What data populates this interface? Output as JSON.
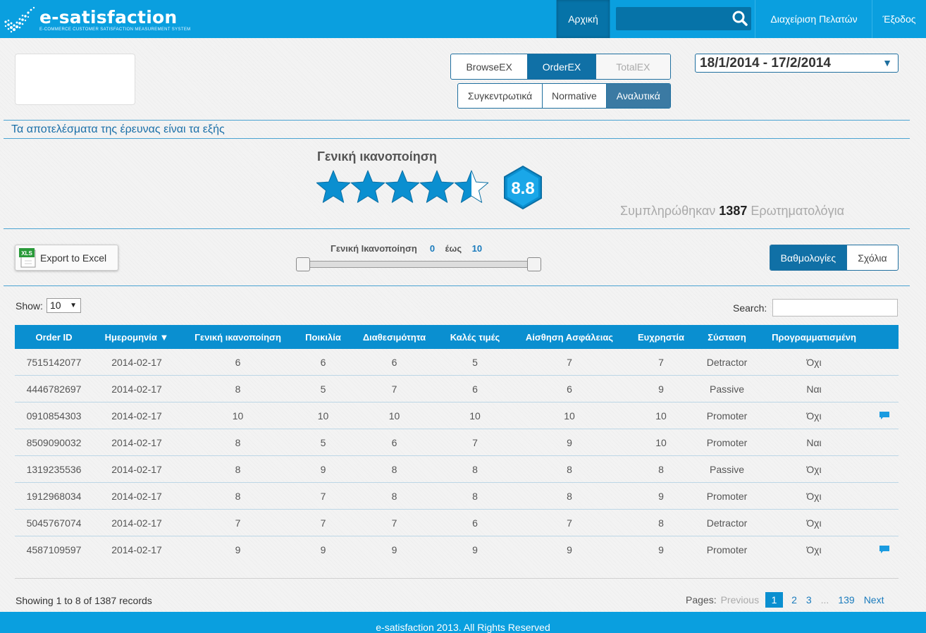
{
  "header": {
    "brand": "e-satisfaction",
    "brand_tagline": "E-COMMERCE CUSTOMER SATISFACTION MEASUREMENT SYSTEM",
    "nav_home": "Αρχική",
    "nav_clients": "Διαχείριση Πελατών",
    "nav_exit": "Έξοδος",
    "search_value": "",
    "accent_color": "#0a9fdf"
  },
  "modes": {
    "survey_types": [
      "BrowseEX",
      "OrderEX",
      "TotalEX"
    ],
    "survey_active": "OrderEX",
    "views": [
      "Συγκεντρωτικά",
      "Normative",
      "Αναλυτικά"
    ],
    "view_active": "Αναλυτικά"
  },
  "date_range": "18/1/2014 - 17/2/2014",
  "results_title": "Τα αποτελέσματα της έρευνας είναι τα εξής",
  "overall": {
    "title": "Γενική ικανοποίηση",
    "stars_filled": 4.5,
    "stars_total": 5,
    "score": "8.8",
    "filled_prefix": "Συμπληρώθηκαν",
    "filled_count": "1387",
    "filled_suffix": "Ερωτηματολόγια"
  },
  "toolbar": {
    "export_label": "Export to Excel",
    "export_icon_text": "XLS",
    "range_label": "Γενική Ικανοποίηση",
    "range_min": "0",
    "range_to": "έως",
    "range_max": "10",
    "tabs": [
      "Βαθμολογίες",
      "Σχόλια"
    ],
    "tab_active": "Βαθμολογίες"
  },
  "table_controls": {
    "show_label": "Show:",
    "show_value": "10",
    "search_label": "Search:",
    "search_value": ""
  },
  "table": {
    "columns": [
      "Order ID",
      "Ημερομηνία ▼",
      "Γενική ικανοποίηση",
      "Ποικιλία",
      "Διαθεσιμότητα",
      "Καλές τιμές",
      "Αίσθηση Ασφάλειας",
      "Ευχρηστία",
      "Σύσταση",
      "Προγραμματισμένη",
      ""
    ],
    "rows": [
      {
        "cells": [
          "7515142077",
          "2014-02-17",
          "6",
          "6",
          "6",
          "5",
          "7",
          "7",
          "Detractor",
          "Όχι"
        ],
        "comment": false
      },
      {
        "cells": [
          "4446782697",
          "2014-02-17",
          "8",
          "5",
          "7",
          "6",
          "6",
          "9",
          "Passive",
          "Ναι"
        ],
        "comment": false
      },
      {
        "cells": [
          "0910854303",
          "2014-02-17",
          "10",
          "10",
          "10",
          "10",
          "10",
          "10",
          "Promoter",
          "Όχι"
        ],
        "comment": true
      },
      {
        "cells": [
          "8509090032",
          "2014-02-17",
          "8",
          "5",
          "6",
          "7",
          "9",
          "10",
          "Promoter",
          "Ναι"
        ],
        "comment": false
      },
      {
        "cells": [
          "1319235536",
          "2014-02-17",
          "8",
          "9",
          "8",
          "8",
          "8",
          "8",
          "Passive",
          "Όχι"
        ],
        "comment": false
      },
      {
        "cells": [
          "1912968034",
          "2014-02-17",
          "8",
          "7",
          "8",
          "8",
          "8",
          "9",
          "Promoter",
          "Όχι"
        ],
        "comment": false
      },
      {
        "cells": [
          "5045767074",
          "2014-02-17",
          "7",
          "7",
          "7",
          "6",
          "7",
          "8",
          "Detractor",
          "Όχι"
        ],
        "comment": false
      },
      {
        "cells": [
          "4587109597",
          "2014-02-17",
          "9",
          "9",
          "9",
          "9",
          "9",
          "9",
          "Promoter",
          "Όχι"
        ],
        "comment": true
      }
    ]
  },
  "pagination": {
    "showing_text": "Showing 1 to 8  of 1387 records",
    "pages_label": "Pages:",
    "previous": "Previous",
    "pages": [
      "1",
      "2",
      "3"
    ],
    "current_page": "1",
    "ellipsis": "...",
    "last_page": "139",
    "next": "Next"
  },
  "footer": {
    "text": "e-satisfaction 2013. All Rights Reserved"
  }
}
